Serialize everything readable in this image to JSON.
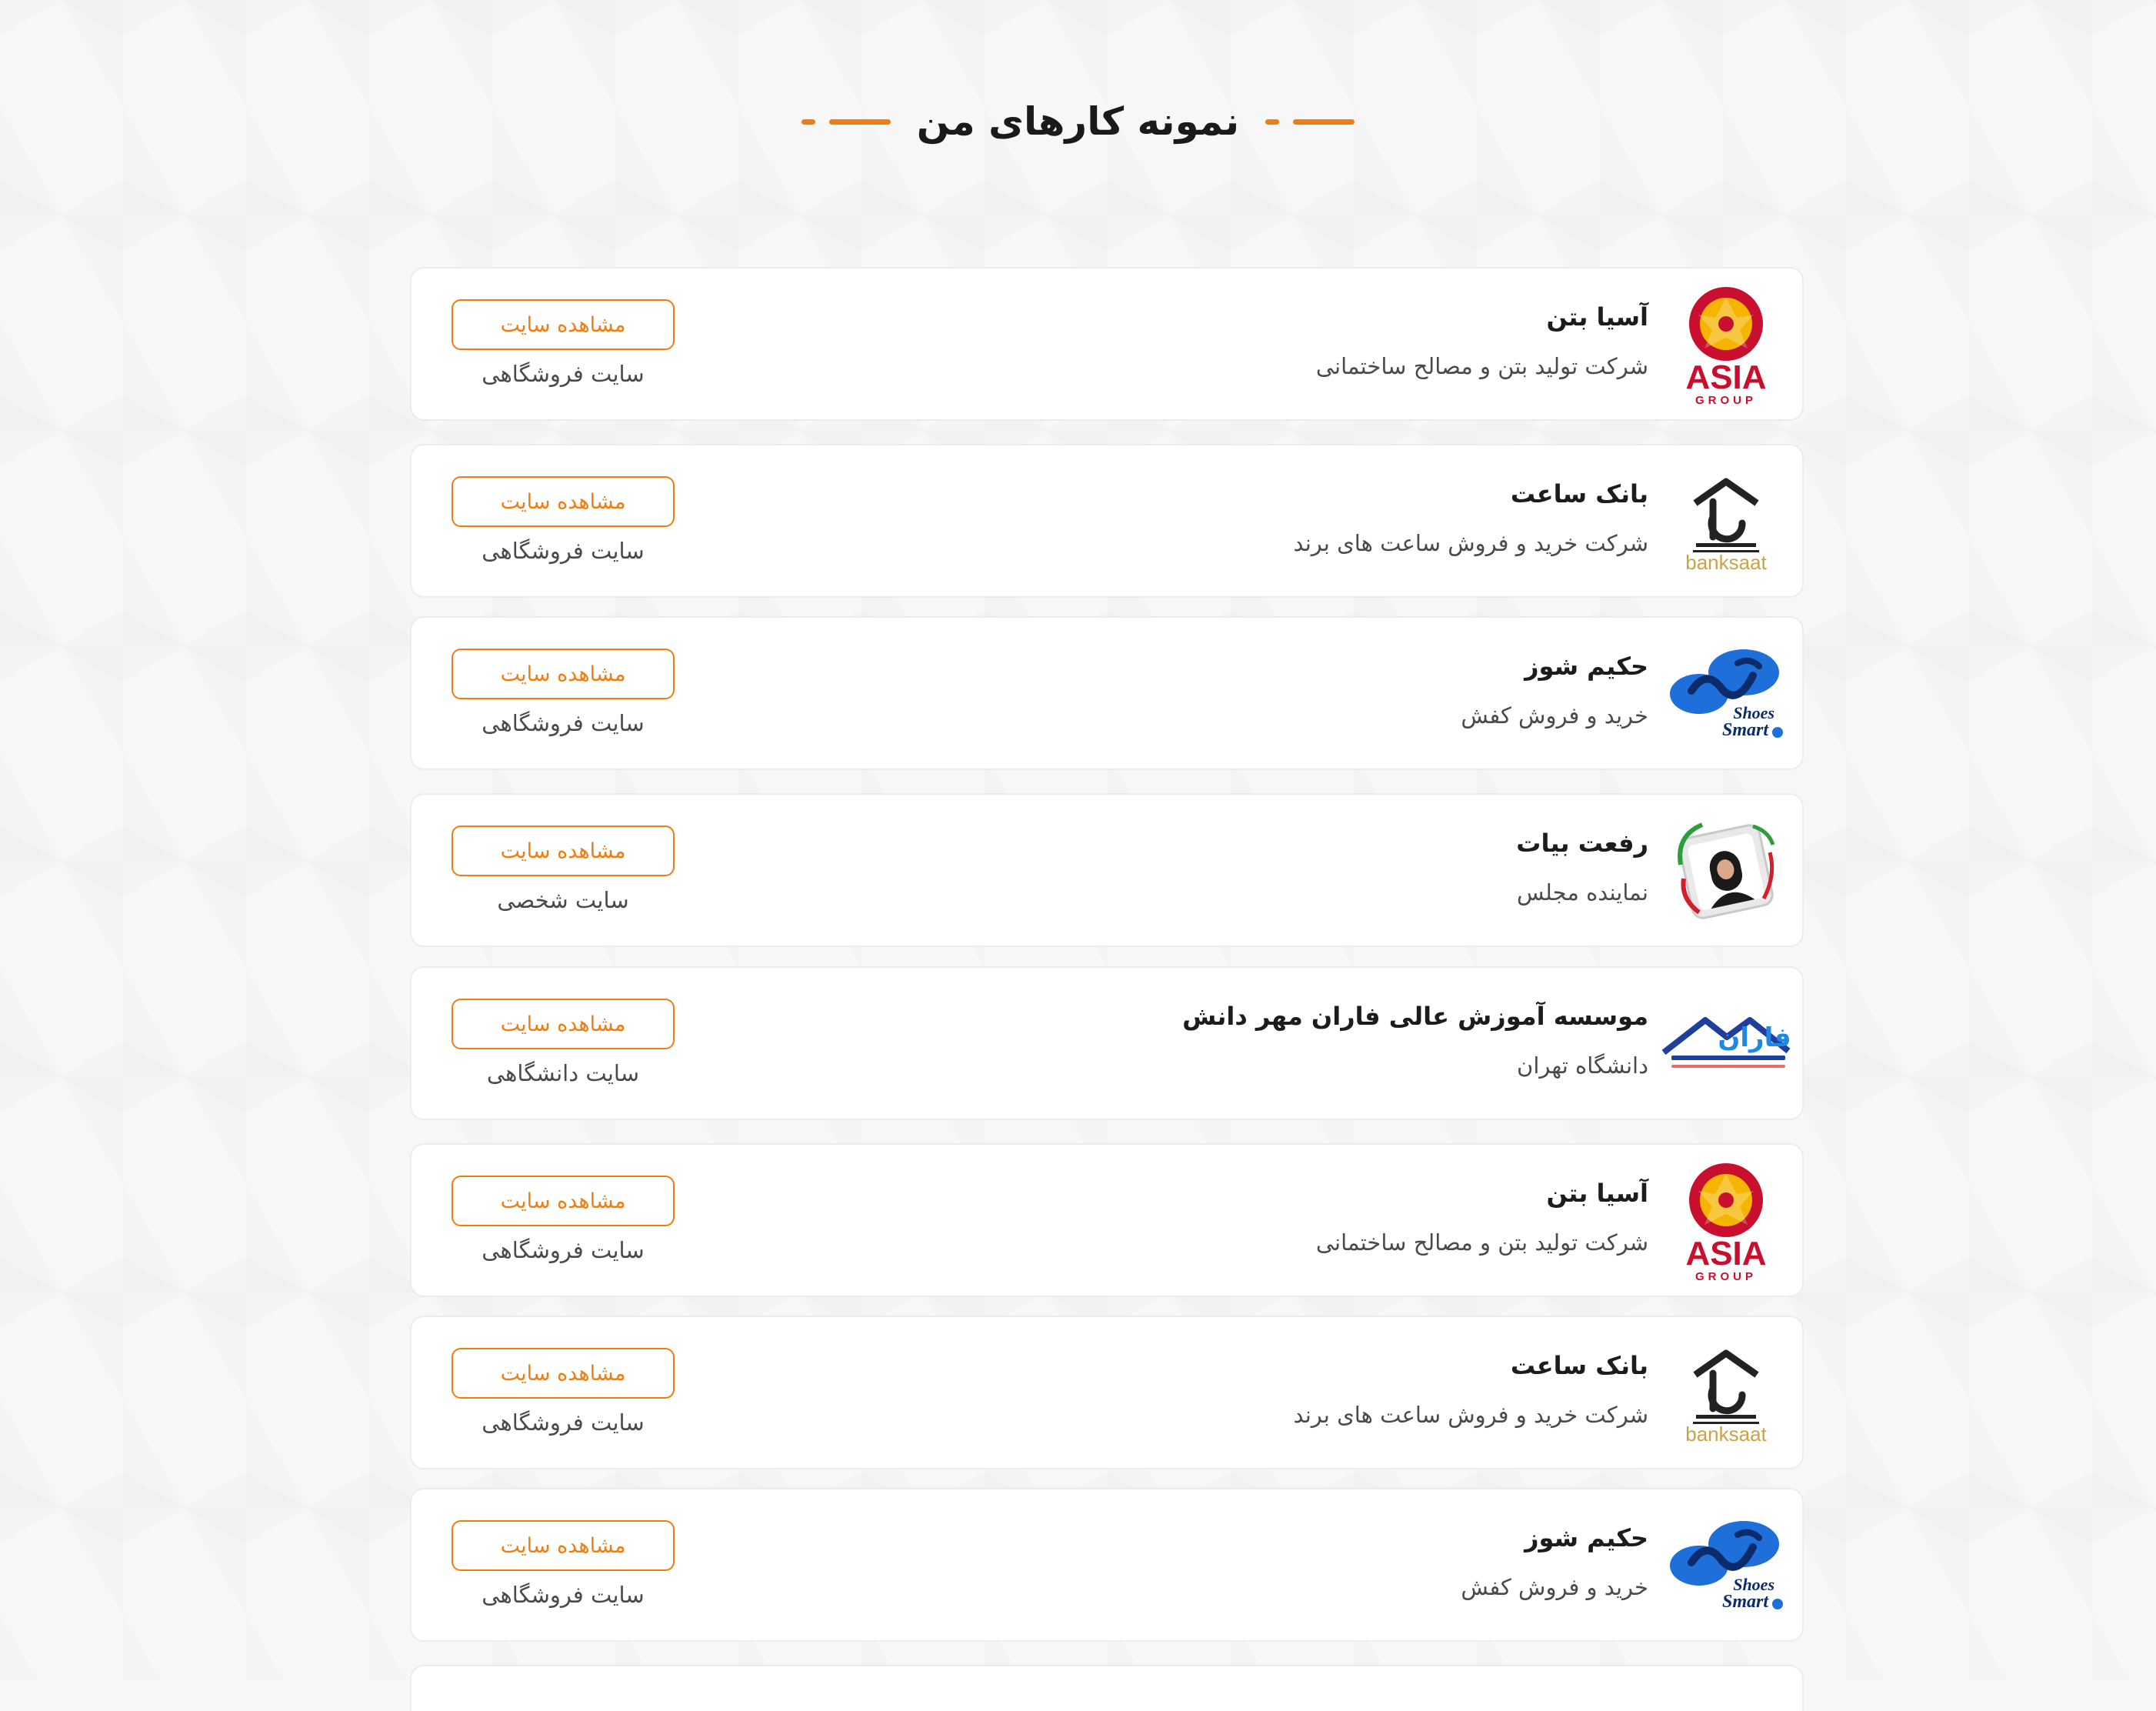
{
  "page": {
    "title": "نمونه کارهای من"
  },
  "colors": {
    "accent": "#f07c12",
    "card_bg": "#ffffff",
    "page_bg": "#f7f7f7"
  },
  "portfolio": [
    {
      "title": "آسیا بتن",
      "subtitle": "شرکت تولید بتن و مصالح ساختمانی",
      "button": "مشاهده سایت",
      "type": "سایت فروشگاهی",
      "logo": "asia-group-logo",
      "logo_text": "ASIA",
      "logo_subtext": "GROUP"
    },
    {
      "title": "بانک ساعت",
      "subtitle": "شرکت خرید و فروش ساعت های برند",
      "button": "مشاهده سایت",
      "type": "سایت فروشگاهی",
      "logo": "bank-saat-logo",
      "logo_text": "banksaat"
    },
    {
      "title": "حکیم شوز",
      "subtitle": "خرید و فروش کفش",
      "button": "مشاهده سایت",
      "type": "سایت فروشگاهی",
      "logo": "smart-shoes-logo",
      "logo_text": "Shoes",
      "logo_subtext": "Smart"
    },
    {
      "title": "رفعت بیات",
      "subtitle": "نماینده مجلس",
      "button": "مشاهده سایت",
      "type": "سایت شخصی",
      "logo": "portrait-logo"
    },
    {
      "title": "موسسه آموزش عالی فاران مهر دانش",
      "subtitle": "دانشگاه تهران",
      "button": "مشاهده سایت",
      "type": "سایت دانشگاهی",
      "logo": "faran-logo",
      "logo_text": "فاران"
    },
    {
      "title": "آسیا بتن",
      "subtitle": "شرکت تولید بتن و مصالح ساختمانی",
      "button": "مشاهده سایت",
      "type": "سایت فروشگاهی",
      "logo": "asia-group-logo",
      "logo_text": "ASIA",
      "logo_subtext": "GROUP"
    },
    {
      "title": "بانک ساعت",
      "subtitle": "شرکت خرید و فروش ساعت های برند",
      "button": "مشاهده سایت",
      "type": "سایت فروشگاهی",
      "logo": "bank-saat-logo",
      "logo_text": "banksaat"
    },
    {
      "title": "حکیم شوز",
      "subtitle": "خرید و فروش کفش",
      "button": "مشاهده سایت",
      "type": "سایت فروشگاهی",
      "logo": "smart-shoes-logo",
      "logo_text": "Shoes",
      "logo_subtext": "Smart"
    }
  ]
}
